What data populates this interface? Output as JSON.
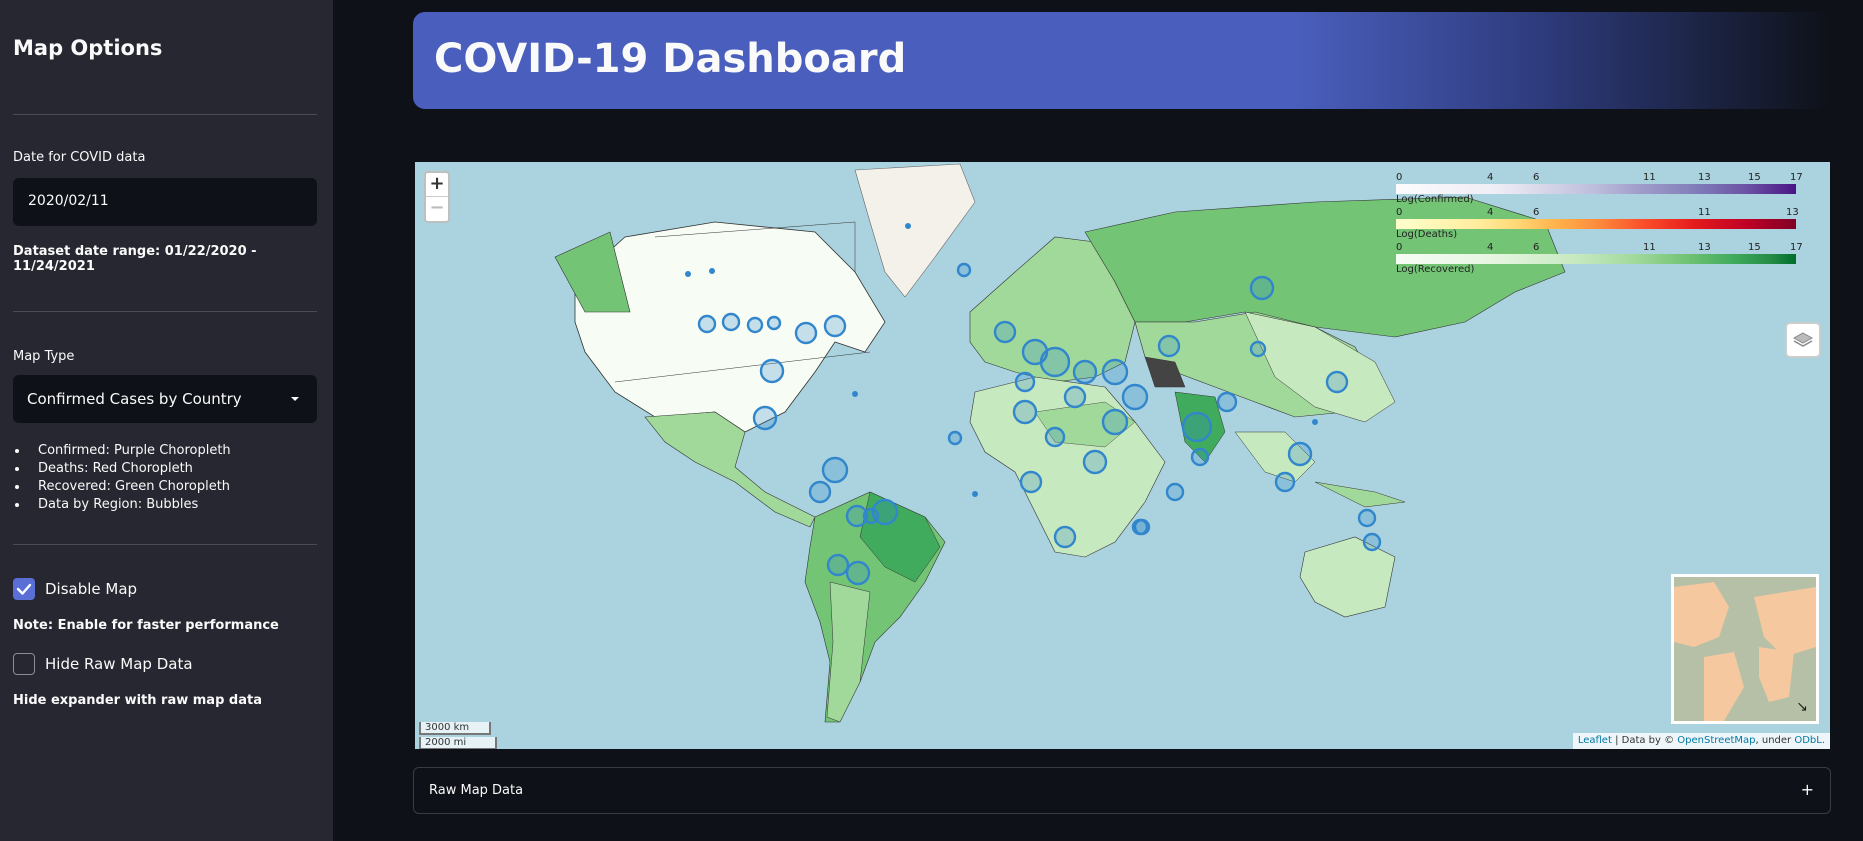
{
  "sidebar": {
    "title": "Map Options",
    "date_label": "Date for COVID data",
    "date_value": "2020/02/11",
    "date_range_note": "Dataset date range: 01/22/2020 - 11/24/2021",
    "map_type_label": "Map Type",
    "map_type_value": "Confirmed Cases by Country",
    "bullets": [
      "Confirmed: Purple Choropleth",
      "Deaths: Red Choropleth",
      "Recovered: Green Choropleth",
      "Data by Region: Bubbles"
    ],
    "disable_map_label": "Disable Map",
    "disable_map_checked": true,
    "disable_map_note": "Note: Enable for faster performance",
    "hide_raw_label": "Hide Raw Map Data",
    "hide_raw_checked": false,
    "hide_raw_note": "Hide expander with raw map data"
  },
  "header": {
    "title": "COVID-19 Dashboard"
  },
  "map": {
    "zoom_in": "+",
    "zoom_out": "−",
    "legends": [
      {
        "caption": "Log(Confirmed)",
        "ticks": [
          "0",
          "4",
          "6",
          "11",
          "13",
          "15",
          "17"
        ]
      },
      {
        "caption": "Log(Deaths)",
        "ticks": [
          "0",
          "4",
          "6",
          "11",
          "13"
        ]
      },
      {
        "caption": "Log(Recovered)",
        "ticks": [
          "0",
          "4",
          "6",
          "11",
          "13",
          "15",
          "17"
        ]
      }
    ],
    "scale_km": "3000 km",
    "scale_mi": "2000 mi",
    "attribution": {
      "leaflet": "Leaflet",
      "data_by": " | Data by © ",
      "osm": "OpenStreetMap",
      "under": ", under ",
      "odbl": "ODbL."
    },
    "colors": {
      "ocean": "#aad3df",
      "bubble": "#3186cc"
    }
  },
  "expander": {
    "label": "Raw Map Data",
    "icon": "+"
  }
}
